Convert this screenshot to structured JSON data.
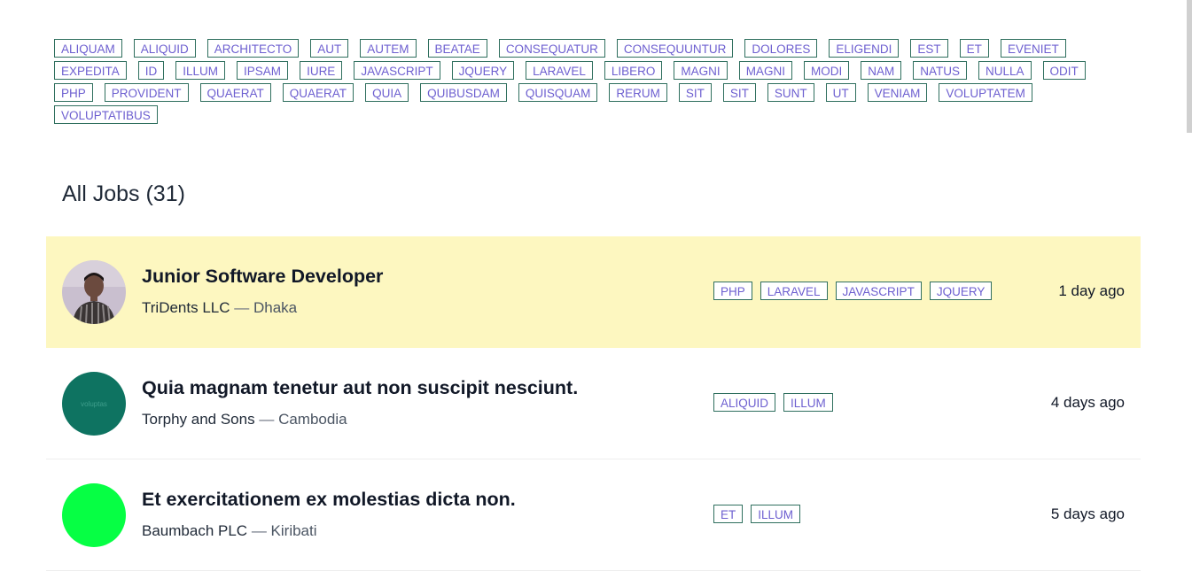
{
  "tag_cloud": [
    "ALIQUAM",
    "ALIQUID",
    "ARCHITECTO",
    "AUT",
    "AUTEM",
    "BEATAE",
    "CONSEQUATUR",
    "CONSEQUUNTUR",
    "DOLORES",
    "ELIGENDI",
    "EST",
    "ET",
    "EVENIET",
    "EXPEDITA",
    "ID",
    "ILLUM",
    "IPSAM",
    "IURE",
    "JAVASCRIPT",
    "JQUERY",
    "LARAVEL",
    "LIBERO",
    "MAGNI",
    "MAGNI",
    "MODI",
    "NAM",
    "NATUS",
    "NULLA",
    "ODIT",
    "PHP",
    "PROVIDENT",
    "QUAERAT",
    "QUAERAT",
    "QUIA",
    "QUIBUSDAM",
    "QUISQUAM",
    "RERUM",
    "SIT",
    "SIT",
    "SUNT",
    "UT",
    "VENIAM",
    "VOLUPTATEM",
    "VOLUPTATIBUS"
  ],
  "jobs_heading": "All Jobs (31)",
  "jobs": [
    {
      "title": "Junior Software Developer",
      "company": "TriDents LLC",
      "separator": "—",
      "location": "Dhaka",
      "tags": [
        "PHP",
        "LARAVEL",
        "JAVASCRIPT",
        "JQUERY"
      ],
      "posted": "1 day ago",
      "featured": true,
      "avatar": {
        "type": "photo",
        "text": ""
      }
    },
    {
      "title": "Quia magnam tenetur aut non suscipit nesciunt.",
      "company": "Torphy and Sons",
      "separator": "—",
      "location": "Cambodia",
      "tags": [
        "ALIQUID",
        "ILLUM"
      ],
      "posted": "4 days ago",
      "featured": false,
      "avatar": {
        "type": "color",
        "color": "#0e7361",
        "text": "voluptas",
        "text_color": "#3f9e8c"
      }
    },
    {
      "title": "Et exercitationem ex molestias dicta non.",
      "company": "Baumbach PLC",
      "separator": "—",
      "location": "Kiribati",
      "tags": [
        "ET",
        "ILLUM"
      ],
      "posted": "5 days ago",
      "featured": false,
      "avatar": {
        "type": "color",
        "color": "#06ff44",
        "text": "",
        "text_color": "#06ff44"
      }
    }
  ]
}
